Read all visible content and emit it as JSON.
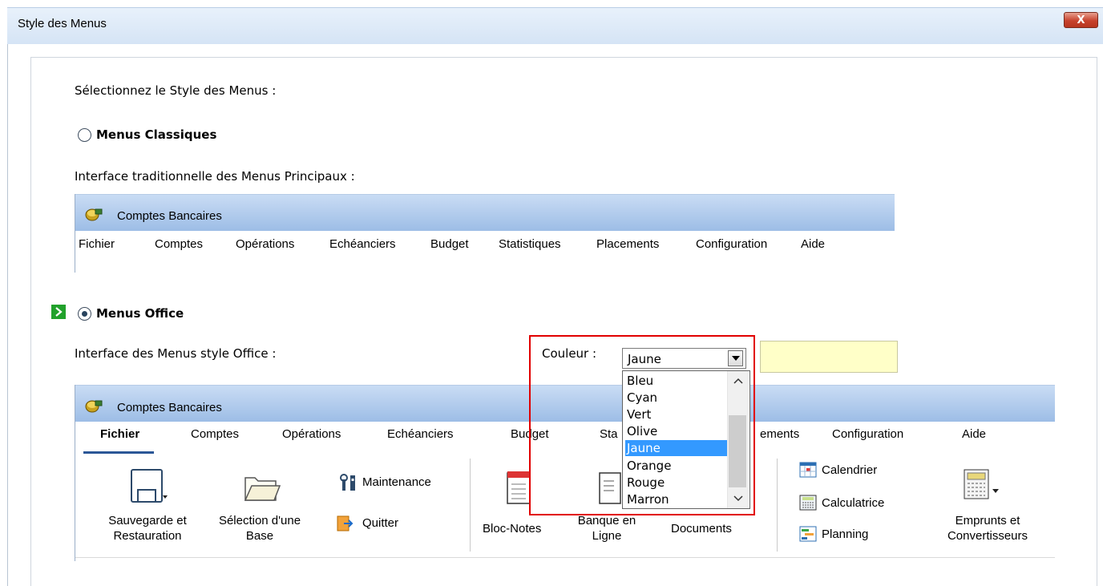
{
  "window": {
    "title": "Style des Menus",
    "close_label": "X"
  },
  "intro": "Sélectionnez le Style des Menus :",
  "classic": {
    "label": "Menus Classiques",
    "description": "Interface traditionnelle des Menus Principaux :",
    "preview_title": "Comptes Bancaires",
    "menu_items": [
      "Fichier",
      "Comptes",
      "Opérations",
      "Echéanciers",
      "Budget",
      "Statistiques",
      "Placements",
      "Configuration",
      "Aide"
    ]
  },
  "office": {
    "label": "Menus Office",
    "description": "Interface des Menus style Office :",
    "color_label": "Couleur :",
    "color_value": "Jaune",
    "color_options": [
      "Bleu",
      "Cyan",
      "Vert",
      "Olive",
      "Jaune",
      "Orange",
      "Rouge",
      "Marron"
    ],
    "selected_color_index": 4,
    "swatch_color": "#ffffc8",
    "preview_title": "Comptes Bancaires",
    "tabs": [
      "Fichier",
      "Comptes",
      "Opérations",
      "Echéanciers",
      "Budget",
      "Sta",
      "ements",
      "Configuration",
      "Aide"
    ],
    "ribbon": {
      "save_label": "Sauvegarde et Restauration",
      "select_label": "Sélection d'une Base",
      "maintenance_label": "Maintenance",
      "quit_label": "Quitter",
      "notes_label": "Bloc-Notes",
      "bank_label": "Banque en Ligne",
      "documents_label": "Documents",
      "calendar_label": "Calendrier",
      "calculator_label": "Calculatrice",
      "planning_label": "Planning",
      "loans_label": "Emprunts et Convertisseurs"
    }
  },
  "colors": {
    "accent_highlight": "#e10000",
    "selection": "#3399ff",
    "tab_underline": "#2b5797"
  }
}
